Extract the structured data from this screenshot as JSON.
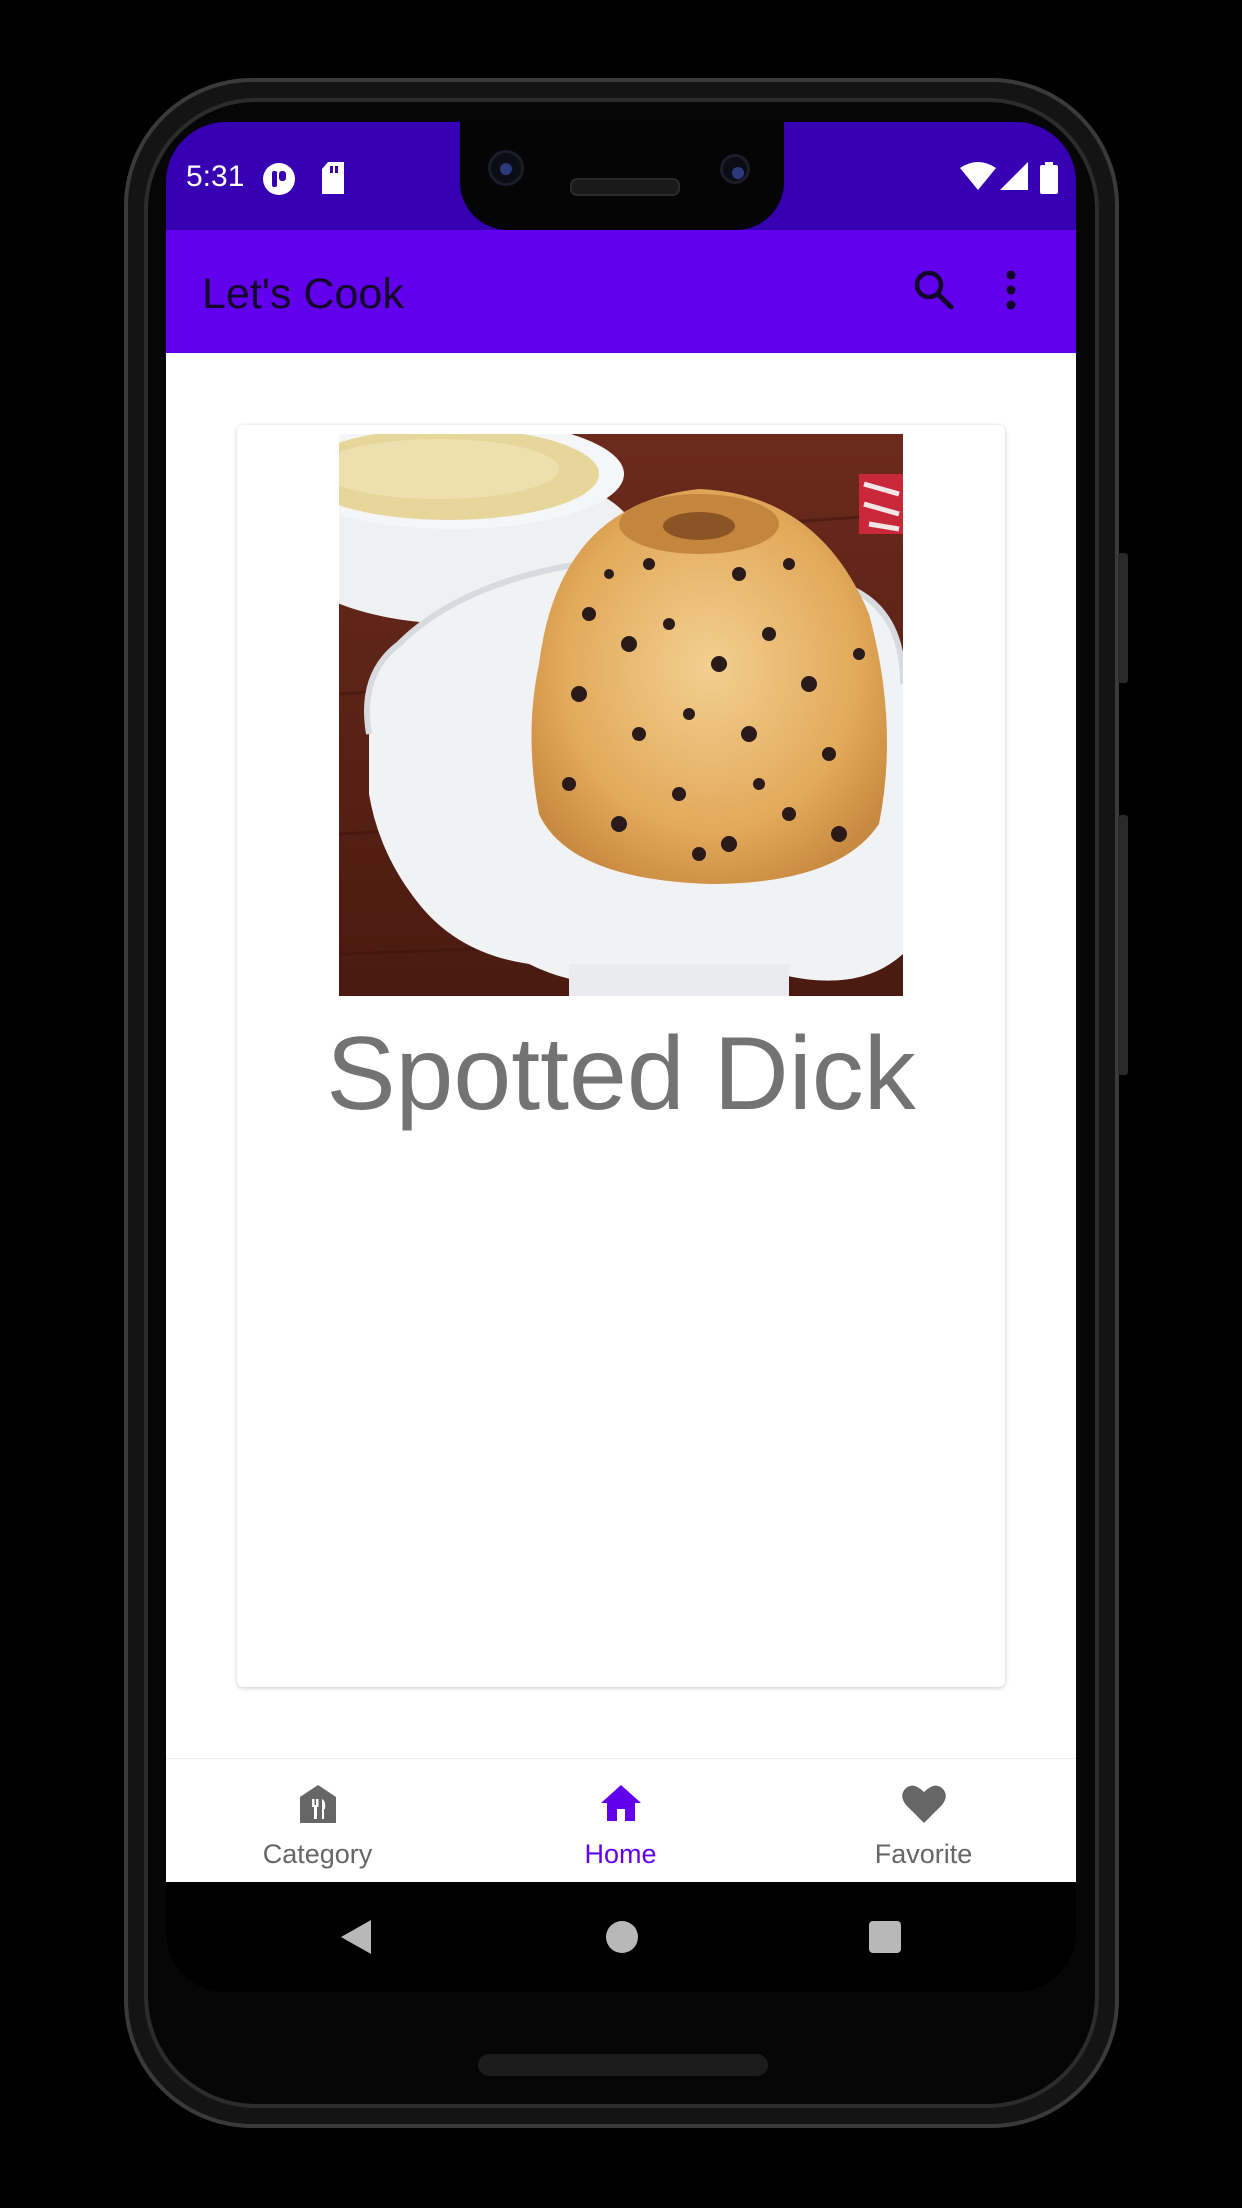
{
  "status_bar": {
    "time": "5:31",
    "left_icons": [
      "app-notification-icon",
      "sd-card-icon"
    ],
    "right_icons": [
      "wifi-icon",
      "cell-signal-icon",
      "battery-icon"
    ]
  },
  "app_bar": {
    "title": "Let's Cook",
    "actions": [
      "search-icon",
      "more-vert-icon"
    ]
  },
  "recipe": {
    "title": "Spotted Dick",
    "image": "spotted-dick-pudding-photo"
  },
  "bottom_nav": {
    "items": [
      {
        "label": "Category",
        "icon": "category-icon",
        "active": false
      },
      {
        "label": "Home",
        "icon": "home-icon",
        "active": true
      },
      {
        "label": "Favorite",
        "icon": "heart-icon",
        "active": false
      }
    ]
  },
  "system_nav": [
    "back-icon",
    "home-circle-icon",
    "recents-icon"
  ],
  "colors": {
    "status_bar": "#3700b3",
    "app_bar": "#6200ee",
    "active_nav": "#6200ee",
    "inactive_nav": "#666666",
    "recipe_title": "#737373"
  }
}
